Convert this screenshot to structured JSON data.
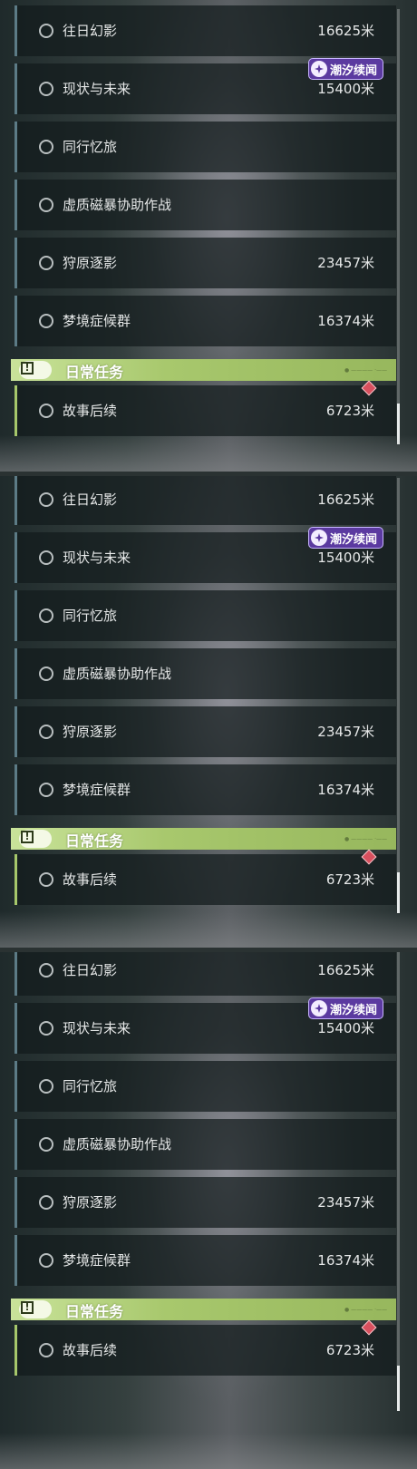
{
  "panels": [
    {
      "quests": [
        {
          "title": "往日幻影",
          "distance": "16625米"
        },
        {
          "title": "现状与未来",
          "distance": "15400米",
          "badge": "潮汐续闻"
        },
        {
          "title": "同行忆旅",
          "distance": ""
        },
        {
          "title": "虚质磁暴协助作战",
          "distance": ""
        },
        {
          "title": "狩原逐影",
          "distance": "23457米"
        },
        {
          "title": "梦境症候群",
          "distance": "16374米"
        }
      ],
      "section": {
        "title": "日常任务",
        "deco": "● ———— ·——"
      },
      "daily": [
        {
          "title": "故事后续",
          "distance": "6723米"
        }
      ]
    },
    {
      "quests": [
        {
          "title": "往日幻影",
          "distance": "16625米"
        },
        {
          "title": "现状与未来",
          "distance": "15400米",
          "badge": "潮汐续闻"
        },
        {
          "title": "同行忆旅",
          "distance": ""
        },
        {
          "title": "虚质磁暴协助作战",
          "distance": ""
        },
        {
          "title": "狩原逐影",
          "distance": "23457米"
        },
        {
          "title": "梦境症候群",
          "distance": "16374米"
        }
      ],
      "section": {
        "title": "日常任务",
        "deco": "● ———— ·——"
      },
      "daily": [
        {
          "title": "故事后续",
          "distance": "6723米"
        }
      ]
    },
    {
      "quests": [
        {
          "title": "往日幻影",
          "distance": "16625米"
        },
        {
          "title": "现状与未来",
          "distance": "15400米",
          "badge": "潮汐续闻"
        },
        {
          "title": "同行忆旅",
          "distance": ""
        },
        {
          "title": "虚质磁暴协助作战",
          "distance": ""
        },
        {
          "title": "狩原逐影",
          "distance": "23457米"
        },
        {
          "title": "梦境症候群",
          "distance": "16374米"
        }
      ],
      "section": {
        "title": "日常任务",
        "deco": "● ———— ·——"
      },
      "daily": [
        {
          "title": "故事后续",
          "distance": "6723米"
        }
      ]
    }
  ],
  "colors": {
    "daily_accent": "#a6c76b",
    "quest_accent": "#5c7b86",
    "badge_bg": "#5b3aa0",
    "marker": "#d8505e"
  },
  "icons": {
    "quest_state": "circle-outline-icon",
    "badge_logo": "tide-star-icon",
    "section": "exclamation-icon",
    "marker": "diamond-marker-icon"
  }
}
